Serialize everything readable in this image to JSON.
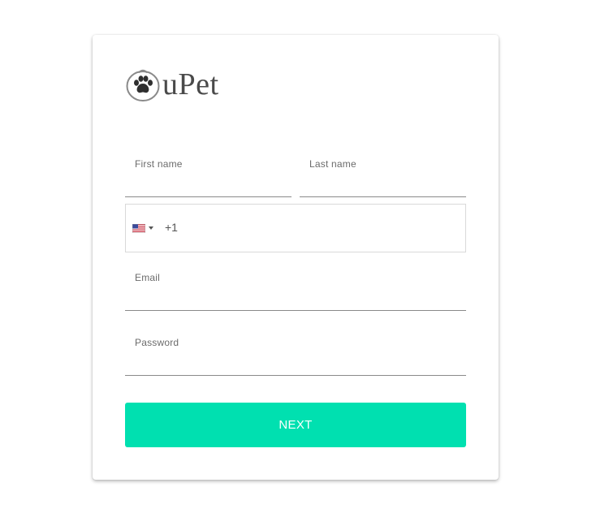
{
  "brand": {
    "name": "uPet",
    "icon": "paw-icon"
  },
  "form": {
    "first_name": {
      "label": "First name",
      "value": ""
    },
    "last_name": {
      "label": "Last name",
      "value": ""
    },
    "phone": {
      "country_icon": "us-flag-icon",
      "dial_code": "+1",
      "value": ""
    },
    "email": {
      "label": "Email",
      "value": ""
    },
    "password": {
      "label": "Password",
      "value": ""
    },
    "next_label": "NEXT"
  },
  "colors": {
    "accent": "#00e0b0",
    "button_text": "#ffffff",
    "logo_text": "#4a4a4a"
  }
}
